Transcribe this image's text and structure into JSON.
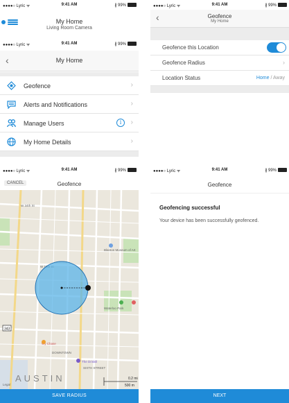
{
  "status_bar": {
    "carrier": "●●●●○ Lyric ᯤ",
    "time": "9:41 AM",
    "battery": "∦ 99%"
  },
  "screen1": {
    "title": "My Home",
    "subtitle": "Living Room Camera"
  },
  "screen2": {
    "title": "My Home",
    "back_icon": "chevron-left-icon",
    "items": [
      {
        "label": "Geofence",
        "icon": "geofence-icon"
      },
      {
        "label": "Alerts and Notifications",
        "icon": "message-icon"
      },
      {
        "label": "Manage Users",
        "icon": "users-icon"
      },
      {
        "label": "My Home Details",
        "icon": "globe-icon"
      }
    ],
    "info_glyph": "i",
    "chevron": "›"
  },
  "screen3": {
    "title": "Geofence",
    "subtitle": "My Home",
    "rows": [
      {
        "label": "Geofence this Location",
        "toggle": true
      },
      {
        "label": "Geofence Radius"
      },
      {
        "label": "Location Status",
        "value_home": "Home",
        "value_sep": " / ",
        "value_away": "Away"
      }
    ]
  },
  "screen4": {
    "cancel_label": "CANCEL",
    "title": "Geofence",
    "save_label": "SAVE RADIUS",
    "map_labels": {
      "street_34th": "W 34th St",
      "museum": "Blanton Museum of Art",
      "street_19th": "W 19th St",
      "street_15th": "W 15th St",
      "waterloo": "Waterloo Park",
      "lamar": "N Lamar Blvd",
      "city": "AUSTIN",
      "downtown": "DOWNTOWN",
      "whole_foods": "Wy Chase",
      "driskill": "The Driskill",
      "sixth": "SIXTH STREET",
      "legal": "Legal",
      "route": "343"
    },
    "scale_top": "0.2 mi",
    "scale_bottom": "500 m"
  },
  "screen5": {
    "title": "Geofence",
    "heading": "Geofencing successful",
    "body": "Your device has been successfully geofenced.",
    "next_label": "NEXT"
  },
  "colors": {
    "accent": "#1f8bd8",
    "map_bg": "#ebe7dd",
    "park": "#c9e3b8",
    "radius_fill": "#5bb4e8"
  }
}
